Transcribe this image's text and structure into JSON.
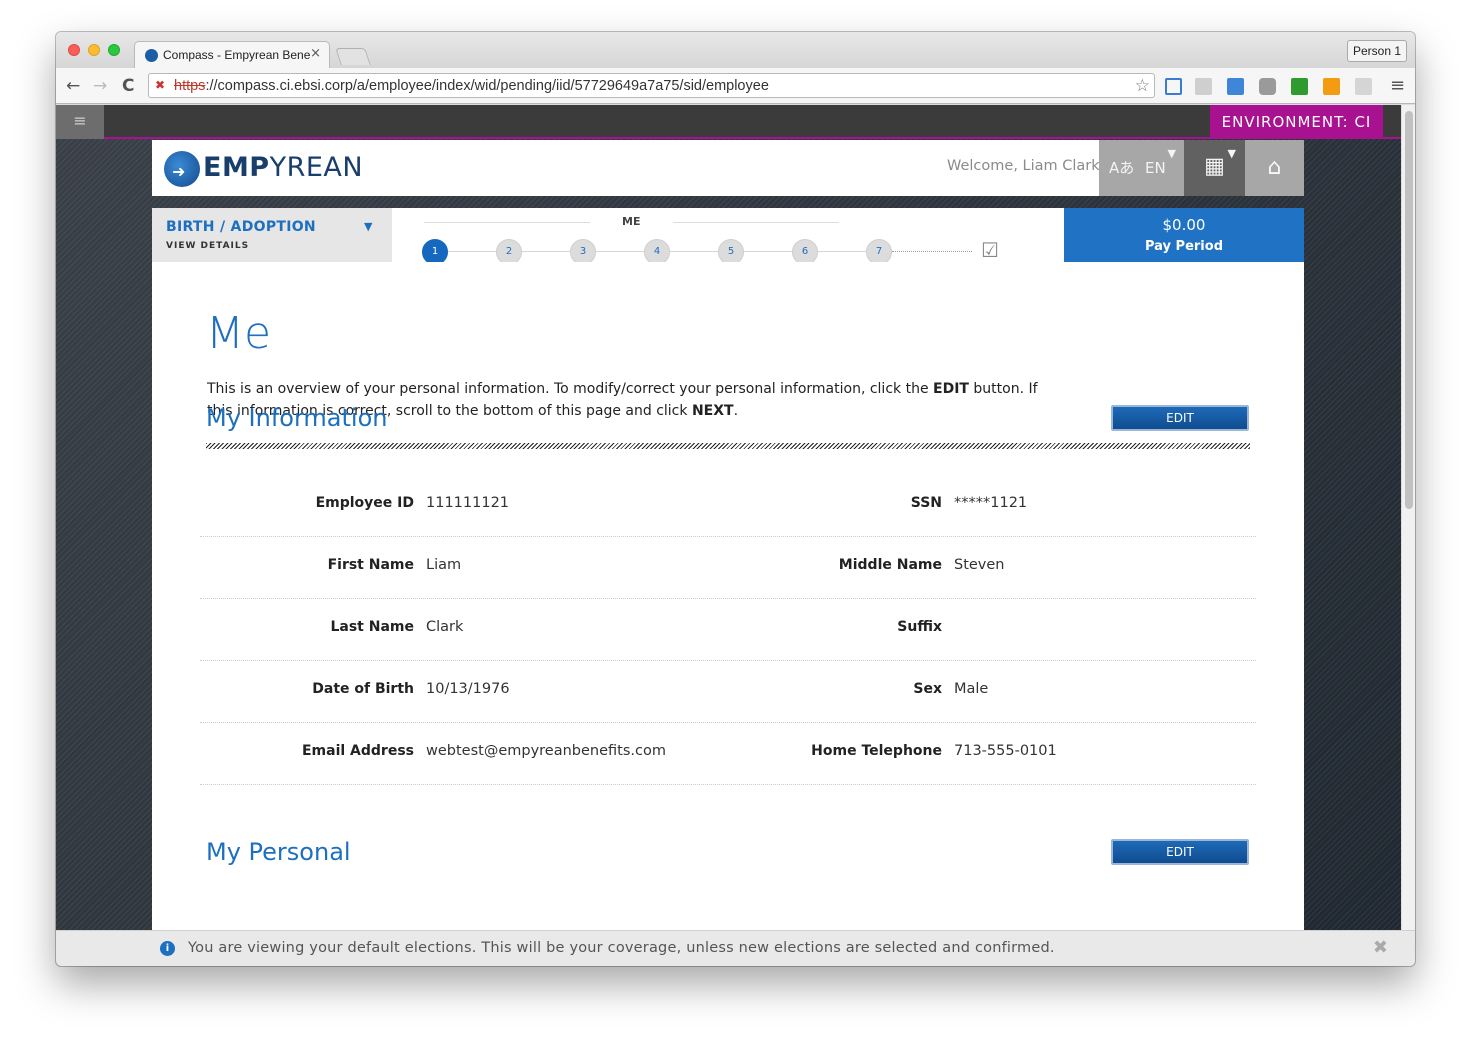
{
  "browser": {
    "tab_title": "Compass - Empyrean Bene",
    "tab_close": "×",
    "profile_button": "Person 1",
    "url_scheme": "https",
    "url_rest": "://compass.ci.ebsi.corp/a/employee/index/wid/pending/iid/57729649a7a75/sid/employee",
    "nav": {
      "back": "←",
      "forward": "→",
      "reload": "C"
    },
    "star": "☆"
  },
  "app": {
    "menu_icon": "≡",
    "environment": "ENVIRONMENT: CI",
    "brand_bold": "EMP",
    "brand_rest": "YREAN",
    "welcome": "Welcome, Liam Clark",
    "language": "EN",
    "language_icon": "Aあ",
    "caret": "▼",
    "calc_icon": "▦",
    "home_icon": "⌂"
  },
  "event": {
    "title": "BIRTH / ADOPTION",
    "subtitle": "VIEW DETAILS",
    "caret": "▼"
  },
  "progress": {
    "label": "ME",
    "steps": [
      "1",
      "2",
      "3",
      "4",
      "5",
      "6",
      "7"
    ],
    "active_step": 1,
    "check_icon": "☑"
  },
  "pay": {
    "amount": "$0.00",
    "label": "Pay Period"
  },
  "page": {
    "title": "Me",
    "intro_1": "This is an overview of your personal information. To modify/correct your personal information, click the ",
    "intro_bold_1": "EDIT",
    "intro_2": " button. If this information is correct, scroll to the bottom of this page and click ",
    "intro_bold_2": "NEXT",
    "intro_3": "."
  },
  "my_information": {
    "title": "My Information",
    "edit_label": "EDIT",
    "rows": [
      {
        "left_label": "Employee ID",
        "left_value": "111111121",
        "right_label": "SSN",
        "right_value": "*****1121"
      },
      {
        "left_label": "First Name",
        "left_value": "Liam",
        "right_label": "Middle Name",
        "right_value": "Steven"
      },
      {
        "left_label": "Last Name",
        "left_value": "Clark",
        "right_label": "Suffix",
        "right_value": ""
      },
      {
        "left_label": "Date of Birth",
        "left_value": "10/13/1976",
        "right_label": "Sex",
        "right_value": "Male"
      },
      {
        "left_label": "Email Address",
        "left_value": "webtest@empyreanbenefits.com",
        "right_label": "Home Telephone",
        "right_value": "713-555-0101"
      }
    ]
  },
  "my_personal": {
    "title": "My Personal",
    "edit_label": "EDIT"
  },
  "notice": {
    "icon": "i",
    "text": "You are viewing your default elections. This will be your coverage, unless new elections are selected and confirmed.",
    "close": "✖"
  }
}
